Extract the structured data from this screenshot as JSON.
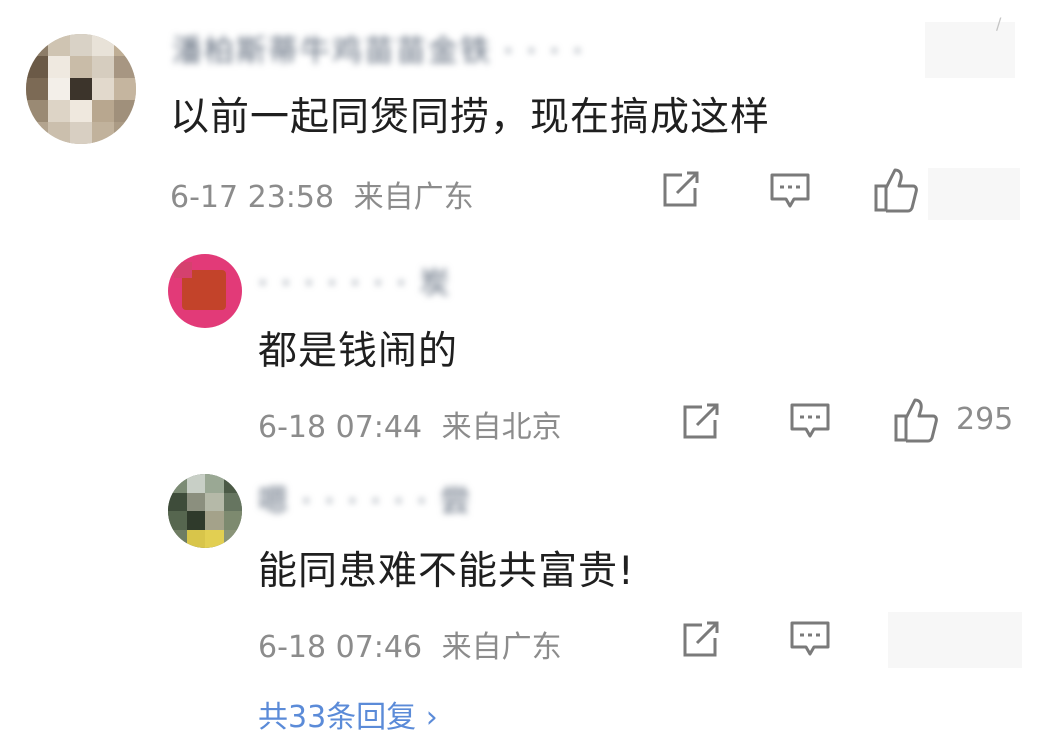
{
  "comments": [
    {
      "username": "潘柏斯蒂牛鸡苗苗金铁 · · · ·",
      "text": "以前一起同煲同捞，现在搞成这样",
      "time": "6-17 23:58",
      "location": "来自广东",
      "likes": ""
    }
  ],
  "replies": [
    {
      "username": "· · · · · · · 炭",
      "text": "都是钱闹的",
      "time": "6-18 07:44",
      "location": "来自北京",
      "likes": "295"
    },
    {
      "username": "嗯 · · · · · · 尝",
      "text": "能同患难不能共富贵!",
      "time": "6-18 07:46",
      "location": "来自广东",
      "likes": ""
    }
  ],
  "more_replies": "共33条回复 ›",
  "icons": [
    "share-icon",
    "reply-icon",
    "like-icon"
  ],
  "colors": {
    "text": "#1f1f1f",
    "meta": "#8c8c8c",
    "link": "#5b8bd8",
    "icon": "#7a7a7a"
  }
}
